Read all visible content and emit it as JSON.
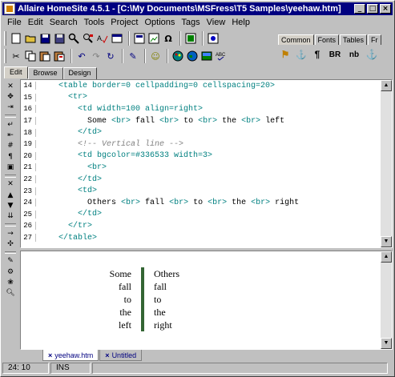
{
  "window": {
    "title": "Allaire HomeSite 4.5.1 - [C:\\My Documents\\MSFress\\T5 Samples\\yeehaw.htm]",
    "controls": {
      "minimize": "_",
      "maximize": "□",
      "close": "×"
    }
  },
  "menu": [
    "File",
    "Edit",
    "Search",
    "Tools",
    "Project",
    "Options",
    "Tags",
    "View",
    "Help"
  ],
  "quickbar": {
    "tabs": [
      "Common",
      "Fonts",
      "Tables",
      "Fr"
    ],
    "active_tab": "Common",
    "icons": [
      {
        "name": "quickstart-icon",
        "glyph": "⚑"
      },
      {
        "name": "anchor-tag-icon",
        "glyph": "⚓"
      },
      {
        "name": "paragraph-icon",
        "glyph": "¶"
      },
      {
        "name": "br-icon",
        "glyph": "BR"
      },
      {
        "name": "nbsp-icon",
        "glyph": "nb"
      },
      {
        "name": "anchor-icon",
        "glyph": "⚓"
      }
    ]
  },
  "toolbar1": [
    "new-file-icon",
    "open-file-icon",
    "save-icon",
    "save-all-icon",
    "find-icon",
    "replace-icon",
    "spell-icon",
    "browse-icon",
    "sep",
    "tag-chooser-icon",
    "image-icon",
    "special-char-icon",
    "sep",
    "validate-icon",
    "sep",
    "link-check-icon"
  ],
  "toolbar2": [
    "cut-icon",
    "copy-icon",
    "paste-icon",
    "paste-special-icon",
    "sep",
    "undo-icon",
    "redo-icon",
    "refresh-icon",
    "sep",
    "tag-insight-icon",
    "sep",
    "smiley-icon",
    "sep",
    "color-icon",
    "globe-icon",
    "image-map-icon",
    "spell-check-icon"
  ],
  "edit_tabs": [
    "Edit",
    "Browse",
    "Design"
  ],
  "active_edit_tab": "Edit",
  "code_lines": [
    {
      "n": "14",
      "parts": [
        {
          "c": "tag",
          "t": "    <table border=0 cellpadding=0 cellspacing=20>"
        }
      ]
    },
    {
      "n": "15",
      "parts": [
        {
          "c": "tag",
          "t": "      <tr>"
        }
      ]
    },
    {
      "n": "16",
      "parts": [
        {
          "c": "tag",
          "t": "        <td width=100 align=right>"
        }
      ]
    },
    {
      "n": "17",
      "parts": [
        {
          "c": "txt",
          "t": "          Some "
        },
        {
          "c": "tag",
          "t": "<br>"
        },
        {
          "c": "txt",
          "t": " fall "
        },
        {
          "c": "tag",
          "t": "<br>"
        },
        {
          "c": "txt",
          "t": " to "
        },
        {
          "c": "tag",
          "t": "<br>"
        },
        {
          "c": "txt",
          "t": " the "
        },
        {
          "c": "tag",
          "t": "<br>"
        },
        {
          "c": "txt",
          "t": " left"
        }
      ]
    },
    {
      "n": "18",
      "parts": [
        {
          "c": "tag",
          "t": "        </td>"
        }
      ]
    },
    {
      "n": "19",
      "parts": [
        {
          "c": "cmt",
          "t": "        <!-- Vertical line -->"
        }
      ]
    },
    {
      "n": "20",
      "parts": [
        {
          "c": "tag",
          "t": "        <td bgcolor=#336533 width=3>"
        }
      ]
    },
    {
      "n": "21",
      "parts": [
        {
          "c": "tag",
          "t": "          <br>"
        }
      ]
    },
    {
      "n": "22",
      "parts": [
        {
          "c": "tag",
          "t": "        </td>"
        }
      ]
    },
    {
      "n": "23",
      "parts": [
        {
          "c": "tag",
          "t": "        <td>"
        }
      ]
    },
    {
      "n": "24",
      "parts": [
        {
          "c": "txt",
          "t": "          Others "
        },
        {
          "c": "tag",
          "t": "<br>"
        },
        {
          "c": "txt",
          "t": " fall "
        },
        {
          "c": "tag",
          "t": "<br>"
        },
        {
          "c": "txt",
          "t": " to "
        },
        {
          "c": "tag",
          "t": "<br>"
        },
        {
          "c": "txt",
          "t": " the "
        },
        {
          "c": "tag",
          "t": "<br>"
        },
        {
          "c": "txt",
          "t": " right"
        }
      ]
    },
    {
      "n": "25",
      "parts": [
        {
          "c": "tag",
          "t": "        </td>"
        }
      ]
    },
    {
      "n": "26",
      "parts": [
        {
          "c": "tag",
          "t": "      </tr>"
        }
      ]
    },
    {
      "n": "27",
      "parts": [
        {
          "c": "tag",
          "t": "    </table>"
        }
      ]
    }
  ],
  "preview": {
    "left": [
      "Some",
      "fall",
      "to",
      "the",
      "left"
    ],
    "right": [
      "Others",
      "fall",
      "to",
      "the",
      "right"
    ],
    "bar_color": "#336533"
  },
  "doc_tabs": [
    {
      "label": "yeehaw.htm",
      "close": "×",
      "active": true
    },
    {
      "label": "Untitled",
      "close": "×",
      "active": false
    }
  ],
  "status": {
    "position": "24: 10",
    "mode": "INS"
  },
  "colors": {
    "title_bar": "#000080",
    "tag_text": "#008080",
    "comment_text": "#808080"
  }
}
